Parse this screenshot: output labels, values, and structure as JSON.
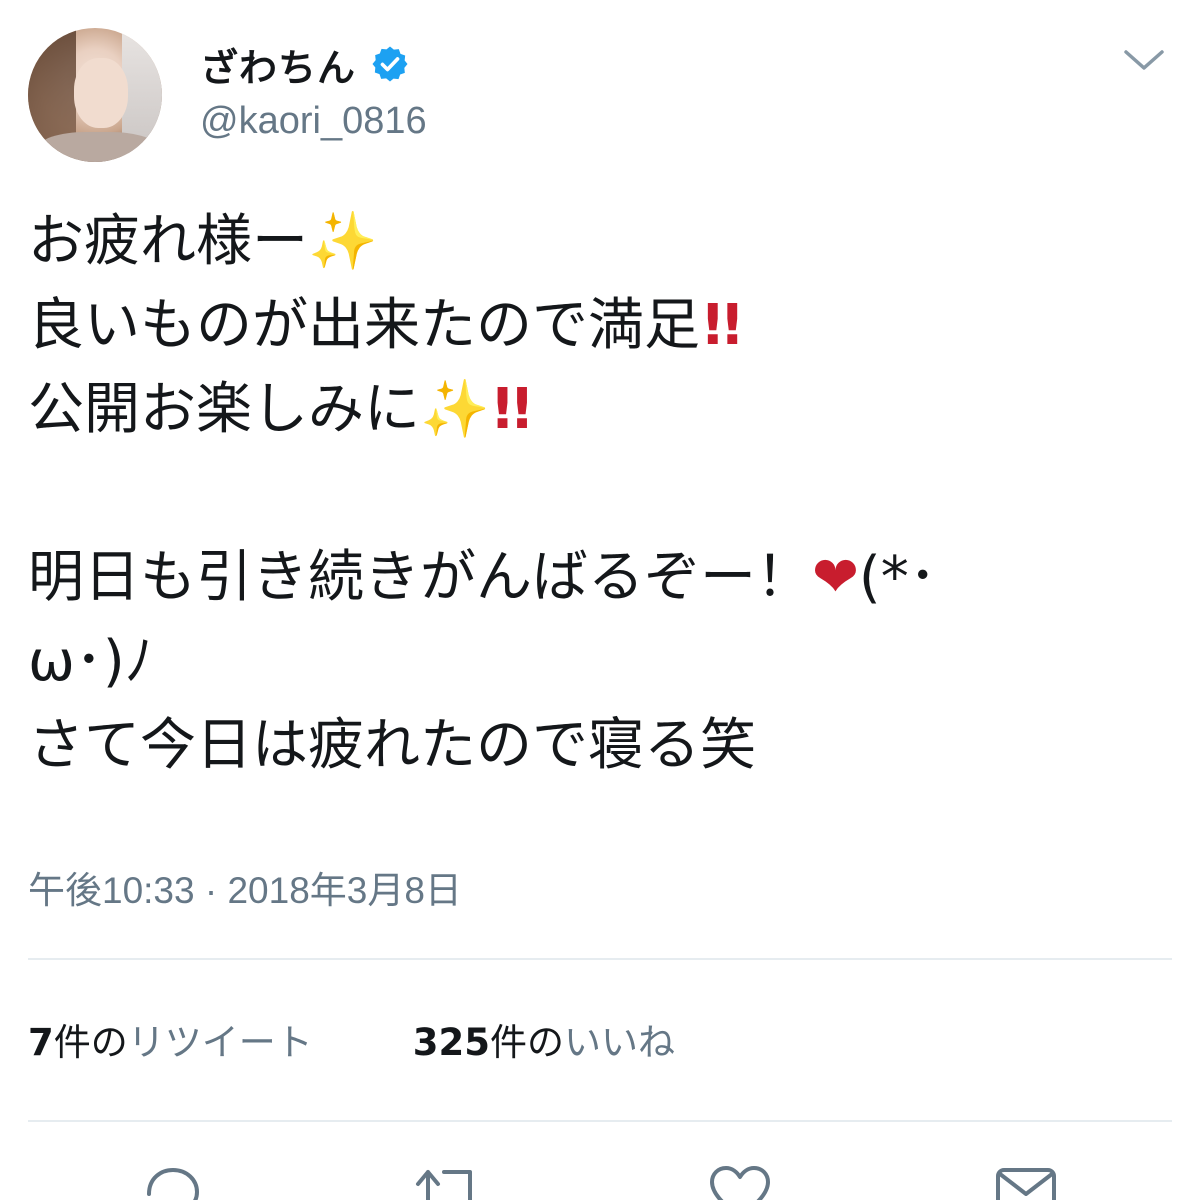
{
  "user": {
    "display_name": "ざわちん",
    "handle": "@kaori_0816",
    "verified": true
  },
  "tweet": {
    "lines": [
      "お疲れ様ー",
      "良いものが出来たので満足",
      "公開お楽しみに",
      "",
      "明日も引き続きがんばるぞー！",
      "ω･)ﾉ",
      "さて今日は疲れたので寝る笑"
    ],
    "emoji": {
      "sparkles": "✨",
      "double_exclamation": "!!",
      "heart": "❤",
      "kaomoji_start": "(*･"
    }
  },
  "timestamp": "午後10:33 · 2018年3月8日",
  "stats": {
    "retweets": {
      "count": "7",
      "unit": "件の",
      "label": "リツイート"
    },
    "likes": {
      "count": "325",
      "unit": "件の",
      "label": "いいね"
    }
  },
  "colors": {
    "verified": "#1da1f2",
    "secondary_text": "#657786",
    "primary_text": "#14171a",
    "divider": "#e6ecf0",
    "accent_red": "#c81d2e",
    "sparkle": "#f6b325"
  },
  "icons": {
    "verified": "verified-badge-icon",
    "menu": "chevron-down-icon",
    "reply": "reply-icon",
    "retweet": "retweet-icon",
    "like": "heart-icon",
    "share": "share-icon"
  }
}
